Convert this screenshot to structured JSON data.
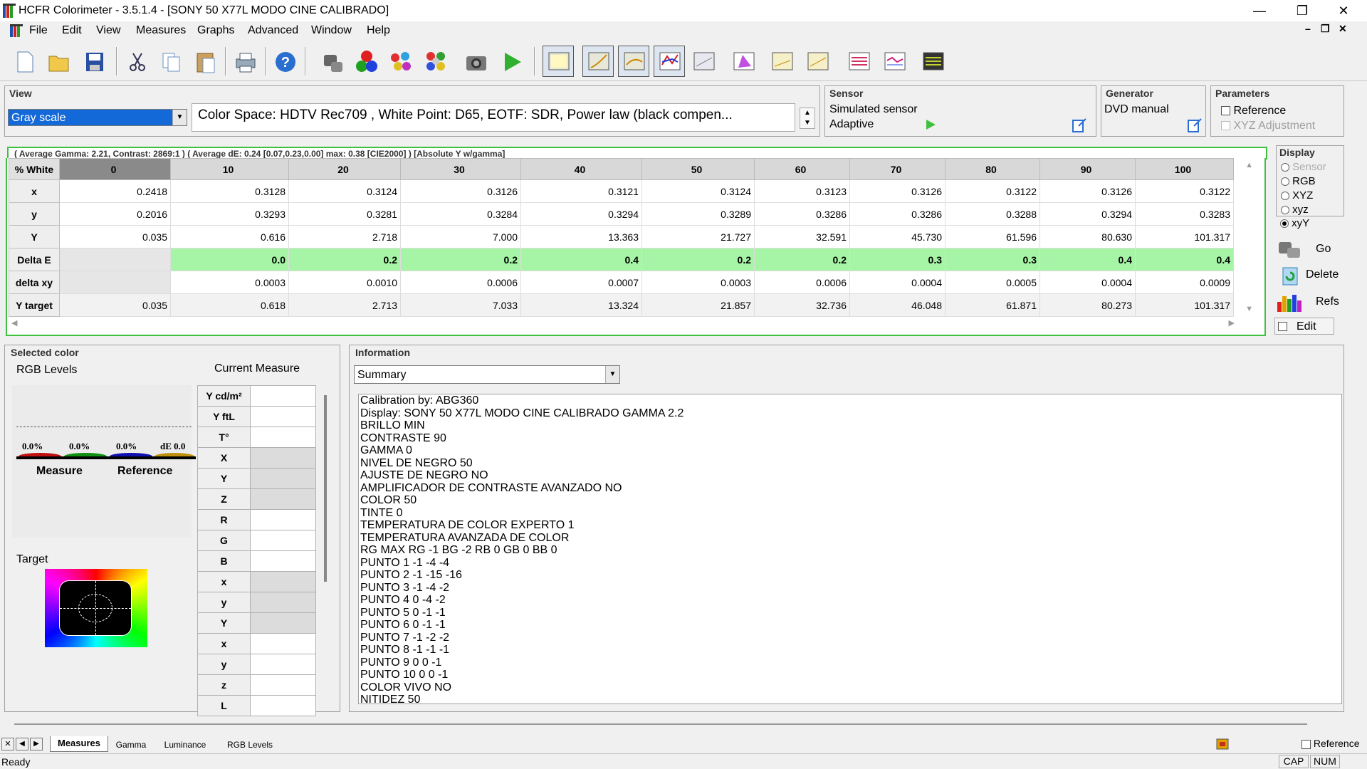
{
  "window": {
    "title": "HCFR Colorimeter - 3.5.1.4 - [SONY 50 X77L MODO CINE CALIBRADO]",
    "minimize": "—",
    "restore": "❐",
    "close": "✕"
  },
  "menu": [
    "File",
    "Edit",
    "View",
    "Measures",
    "Graphs",
    "Advanced",
    "Window",
    "Help"
  ],
  "view": {
    "label": "View",
    "selected": "Gray scale",
    "info": "Color Space: HDTV Rec709 , White Point: D65, EOTF:  SDR, Power law (black compen..."
  },
  "sensor": {
    "label": "Sensor",
    "name": "Simulated sensor",
    "mode": "Adaptive"
  },
  "generator": {
    "label": "Generator",
    "name": "DVD manual"
  },
  "parameters": {
    "label": "Parameters",
    "reference": "Reference",
    "xyz_adjustment": "XYZ Adjustment"
  },
  "summary_line": "( Average Gamma: 2.21, Contrast: 2869:1 ) ( Average dE: 0.24 [0.07,0.23,0.00] max: 0.38 [CIE2000] ) [Absolute Y w/gamma]",
  "grid": {
    "corner": "% White",
    "columns": [
      "0",
      "10",
      "20",
      "30",
      "40",
      "50",
      "60",
      "70",
      "80",
      "90",
      "100"
    ],
    "rows": [
      {
        "label": "x",
        "values": [
          "0.2418",
          "0.3128",
          "0.3124",
          "0.3126",
          "0.3121",
          "0.3124",
          "0.3123",
          "0.3126",
          "0.3122",
          "0.3126",
          "0.3122"
        ]
      },
      {
        "label": "y",
        "values": [
          "0.2016",
          "0.3293",
          "0.3281",
          "0.3284",
          "0.3294",
          "0.3289",
          "0.3286",
          "0.3286",
          "0.3288",
          "0.3294",
          "0.3283"
        ]
      },
      {
        "label": "Y",
        "values": [
          "0.035",
          "0.616",
          "2.718",
          "7.000",
          "13.363",
          "21.727",
          "32.591",
          "45.730",
          "61.596",
          "80.630",
          "101.317"
        ]
      },
      {
        "label": "Delta E",
        "values": [
          "",
          "0.0",
          "0.2",
          "0.2",
          "0.4",
          "0.2",
          "0.2",
          "0.3",
          "0.3",
          "0.4",
          "0.4"
        ]
      },
      {
        "label": "delta xy",
        "values": [
          "",
          "0.0003",
          "0.0010",
          "0.0006",
          "0.0007",
          "0.0003",
          "0.0006",
          "0.0004",
          "0.0005",
          "0.0004",
          "0.0009"
        ]
      },
      {
        "label": "Y target",
        "values": [
          "0.035",
          "0.618",
          "2.713",
          "7.033",
          "13.324",
          "21.857",
          "32.736",
          "46.048",
          "61.871",
          "80.273",
          "101.317"
        ]
      }
    ]
  },
  "display": {
    "label": "Display",
    "options": [
      "Sensor",
      "RGB",
      "XYZ",
      "xyz",
      "xyY"
    ],
    "selected": "xyY",
    "go": "Go",
    "delete": "Delete",
    "refs": "Refs",
    "edit": "Edit"
  },
  "selected_color": {
    "label": "Selected color",
    "rgb_levels": "RGB Levels",
    "current_measure": "Current Measure",
    "levels": [
      "0.0%",
      "0.0%",
      "0.0%",
      "dE 0.0"
    ],
    "measure": "Measure",
    "reference": "Reference",
    "target": "Target",
    "measure_rows": [
      "Y cd/m²",
      "Y ftL",
      "T°",
      "X",
      "Y",
      "Z",
      "R",
      "G",
      "B",
      "x",
      "y",
      "Y",
      "x",
      "y",
      "z",
      "L"
    ]
  },
  "information": {
    "label": "Information",
    "selected": "Summary",
    "lines": [
      "Calibration by: ABG360",
      "Display: SONY 50 X77L MODO CINE CALIBRADO GAMMA 2.2",
      "BRILLO MIN",
      "CONTRASTE 90",
      "GAMMA 0",
      "NIVEL DE NEGRO 50",
      "AJUSTE DE NEGRO NO",
      "AMPLIFICADOR DE CONTRASTE AVANZADO NO",
      "COLOR 50",
      "TINTE 0",
      "TEMPERATURA DE COLOR EXPERTO 1",
      "TEMPERATURA AVANZADA DE COLOR",
      "RG MAX RG -1 BG -2 RB 0 GB 0 BB 0",
      "PUNTO 1 -1 -4 -4",
      "PUNTO 2 -1 -15 -16",
      "PUNTO 3 -1 -4 -2",
      "PUNTO 4 0 -4 -2",
      "PUNTO 5 0 -1 -1",
      "PUNTO 6 0 -1 -1",
      "PUNTO 7 -1 -2 -2",
      "PUNTO 8 -1 -1 -1",
      "PUNTO 9 0 0 -1",
      "PUNTO 10 0 0 -1",
      "COLOR VIVO NO",
      "NITIDEZ 50"
    ]
  },
  "tabs": [
    "Measures",
    "Gamma",
    "Luminance",
    "RGB Levels"
  ],
  "active_tab": "Measures",
  "bottom_reference": "Reference",
  "status": {
    "text": "Ready",
    "cap": "CAP",
    "num": "NUM"
  }
}
